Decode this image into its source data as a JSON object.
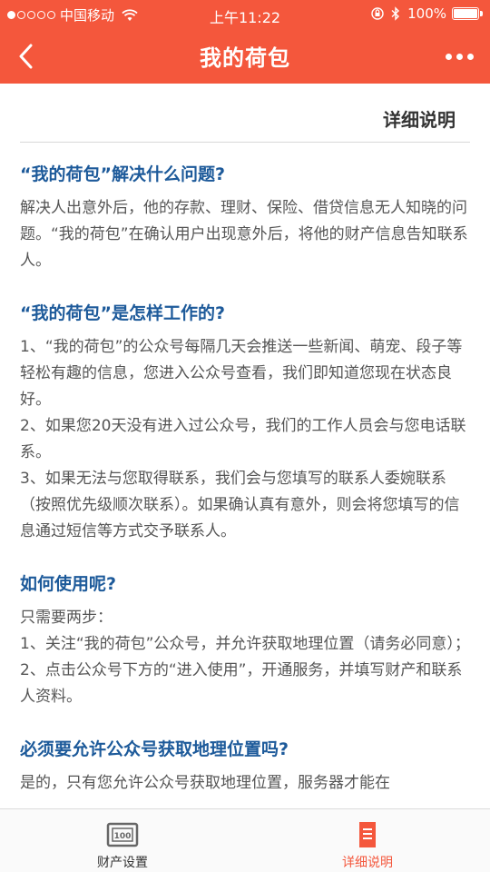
{
  "status_bar": {
    "carrier": "中国移动",
    "time": "上午11:22",
    "battery": "100%"
  },
  "nav": {
    "title": "我的荷包"
  },
  "page": {
    "label": "详细说明"
  },
  "sections": [
    {
      "heading": "“我的荷包”解决什么问题?",
      "body": "解决人出意外后，他的存款、理财、保险、借贷信息无人知晓的问题。“我的荷包”在确认用户出现意外后，将他的财产信息告知联系人。"
    },
    {
      "heading": "“我的荷包”是怎样工作的?",
      "body": "1、“我的荷包”的公众号每隔几天会推送一些新闻、萌宠、段子等轻松有趣的信息，您进入公众号查看，我们即知道您现在状态良好。\n2、如果您20天没有进入过公众号，我们的工作人员会与您电话联系。\n3、如果无法与您取得联系，我们会与您填写的联系人委婉联系（按照优先级顺次联系）。如果确认真有意外，则会将您填写的信息通过短信等方式交予联系人。"
    },
    {
      "heading": "如何使用呢?",
      "body": "只需要两步：\n1、关注“我的荷包”公众号，并允许获取地理位置（请务必同意）；\n2、点击公众号下方的“进入使用”，开通服务，并填写财产和联系人资料。"
    },
    {
      "heading": "必须要允许公众号获取地理位置吗?",
      "body": "是的，只有您允许公众号获取地理位置，服务器才能在"
    }
  ],
  "tabbar": {
    "tabs": [
      {
        "label": "财产设置",
        "icon": "wallet-100-icon"
      },
      {
        "label": "详细说明",
        "icon": "document-icon"
      }
    ],
    "active_color": "#f4573c"
  },
  "colors": {
    "header": "#f4573c",
    "heading": "#1d5a9a"
  }
}
